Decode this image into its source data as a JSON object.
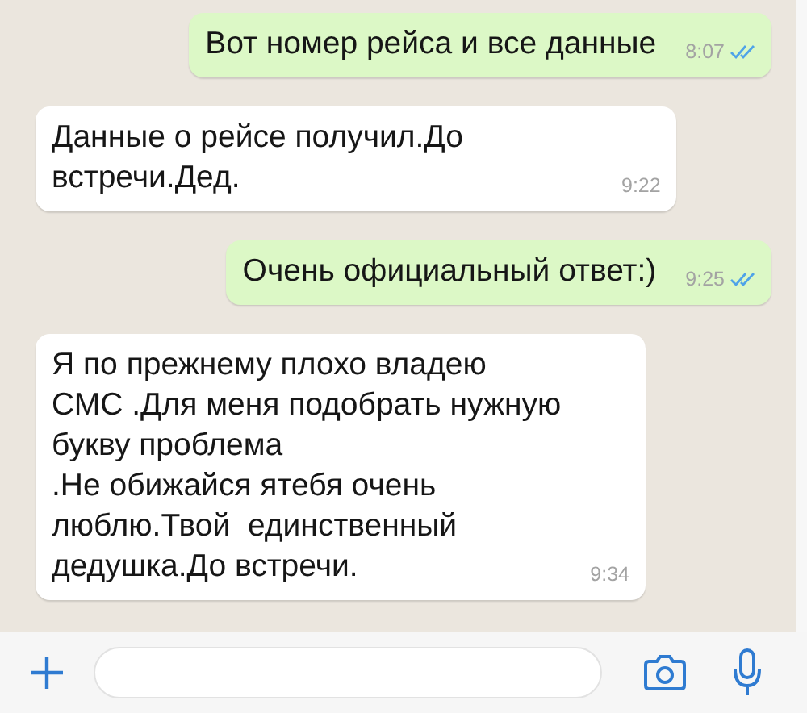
{
  "messages": [
    {
      "kind": "outgoing",
      "text": "Вот номер рейса и все данные",
      "time": "8:07",
      "read": true
    },
    {
      "kind": "incoming",
      "text": "Данные о рейсе получил.До встречи.Дед.",
      "time": "9:22"
    },
    {
      "kind": "outgoing",
      "text": "Очень официальный ответ:)",
      "time": "9:25",
      "read": true
    },
    {
      "kind": "incoming",
      "text": "Я по прежнему плохо владею\nСМС .Для меня подобрать нужную\nбукву проблема\n.Не обижайся ятебя очень\nлюблю.Твой  единственный\nдедушка.До встречи.",
      "time": "9:34"
    }
  ]
}
